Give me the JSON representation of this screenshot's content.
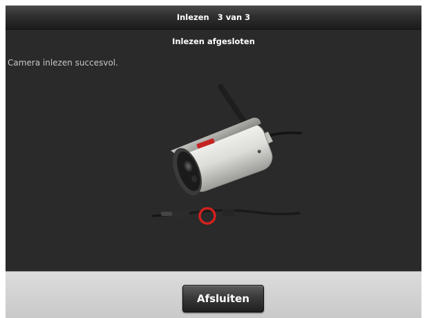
{
  "dialog": {
    "title": "Inlezen",
    "step": "3 van 3",
    "subtitle": "Inlezen afgesloten",
    "message": "Camera inlezen succesvol.",
    "close_label": "Afsluiten"
  },
  "illustration": {
    "subject": "outdoor-wifi-camera",
    "highlight": "connector",
    "highlight_color": "#d42020"
  },
  "colors": {
    "panel_bg": "#2a2a2a",
    "footer_bg": "#d4d4d4",
    "text": "#ffffff"
  }
}
